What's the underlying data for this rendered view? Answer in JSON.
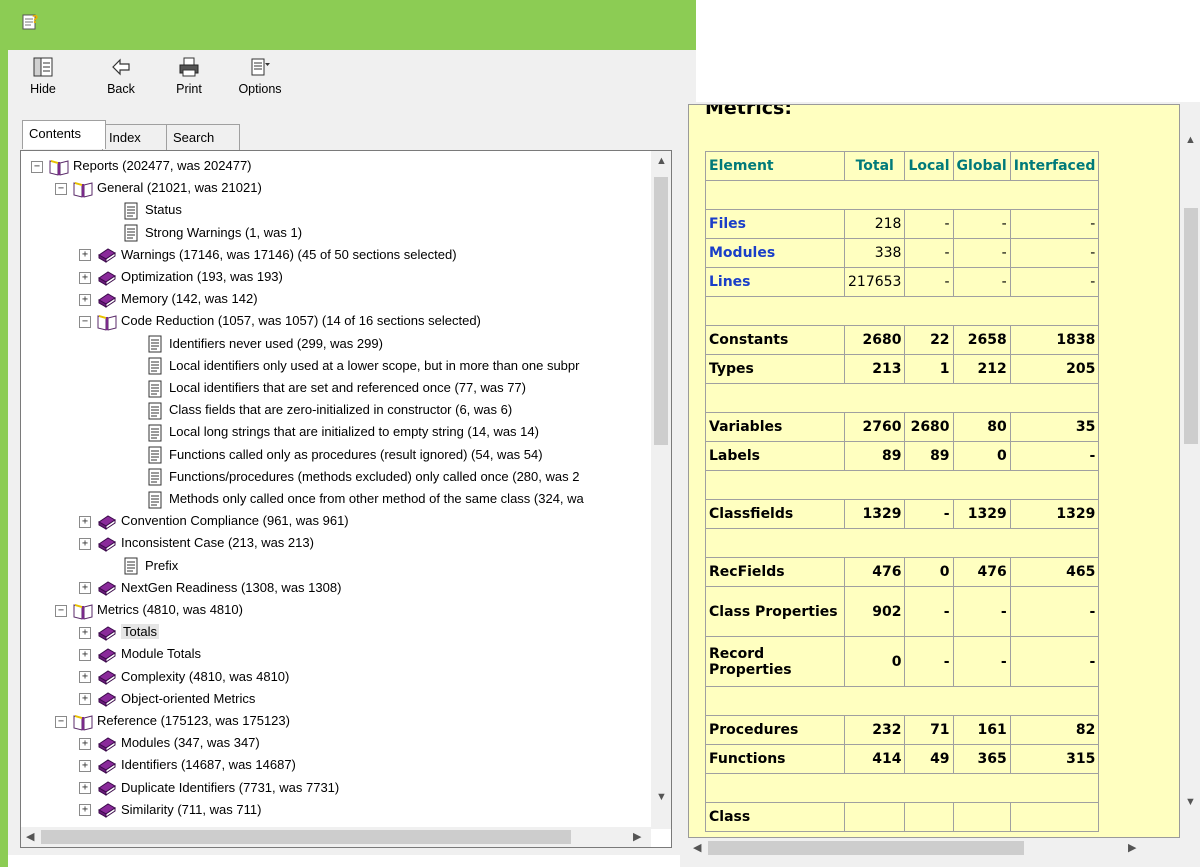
{
  "toolbar": {
    "hide_label": "Hide",
    "back_label": "Back",
    "print_label": "Print",
    "options_label": "Options"
  },
  "tabs": [
    "Contents",
    "Index",
    "Search"
  ],
  "tree": [
    {
      "label": "Reports (202477, was 202477)",
      "icon": "open-book-icon",
      "toggle": "−"
    },
    {
      "label": "General (21021, was 21021)",
      "icon": "open-book-icon",
      "toggle": "−"
    },
    {
      "label": "Status",
      "icon": "page-icon",
      "toggle": ""
    },
    {
      "label": "Strong Warnings (1, was 1)",
      "icon": "page-icon",
      "toggle": ""
    },
    {
      "label": "Warnings (17146, was 17146) (45 of 50 sections selected)",
      "icon": "closed-book-icon",
      "toggle": "+"
    },
    {
      "label": "Optimization (193, was 193)",
      "icon": "closed-book-icon",
      "toggle": "+"
    },
    {
      "label": "Memory (142, was 142)",
      "icon": "closed-book-icon",
      "toggle": "+"
    },
    {
      "label": "Code Reduction (1057, was 1057) (14 of 16 sections selected)",
      "icon": "open-book-icon",
      "toggle": "−"
    },
    {
      "label": "Identifiers never used (299, was 299)",
      "icon": "page-icon",
      "toggle": ""
    },
    {
      "label": "Local identifiers only used at a lower scope, but in more than one subpr",
      "icon": "page-icon",
      "toggle": ""
    },
    {
      "label": "Local identifiers that are set and referenced once (77, was 77)",
      "icon": "page-icon",
      "toggle": ""
    },
    {
      "label": "Class fields that are zero-initialized in constructor (6, was 6)",
      "icon": "page-icon",
      "toggle": ""
    },
    {
      "label": "Local long strings that are initialized to empty string (14, was 14)",
      "icon": "page-icon",
      "toggle": ""
    },
    {
      "label": "Functions called only as procedures (result ignored) (54, was 54)",
      "icon": "page-icon",
      "toggle": ""
    },
    {
      "label": "Functions/procedures (methods excluded) only called once (280, was 2",
      "icon": "page-icon",
      "toggle": ""
    },
    {
      "label": "Methods only called once from other method of the same class (324, wa",
      "icon": "page-icon",
      "toggle": ""
    },
    {
      "label": "Convention Compliance (961, was 961)",
      "icon": "closed-book-icon",
      "toggle": "+"
    },
    {
      "label": "Inconsistent Case (213, was 213)",
      "icon": "closed-book-icon",
      "toggle": "+"
    },
    {
      "label": "Prefix",
      "icon": "page-icon",
      "toggle": ""
    },
    {
      "label": "NextGen Readiness (1308, was 1308)",
      "icon": "closed-book-icon",
      "toggle": "+"
    },
    {
      "label": "Metrics (4810, was 4810)",
      "icon": "open-book-icon",
      "toggle": "−"
    },
    {
      "label": "Totals",
      "icon": "closed-book-icon",
      "toggle": "+"
    },
    {
      "label": "Module Totals",
      "icon": "closed-book-icon",
      "toggle": "+"
    },
    {
      "label": "Complexity (4810, was 4810)",
      "icon": "closed-book-icon",
      "toggle": "+"
    },
    {
      "label": "Object-oriented Metrics",
      "icon": "closed-book-icon",
      "toggle": "+"
    },
    {
      "label": "Reference (175123, was 175123)",
      "icon": "open-book-icon",
      "toggle": "−"
    },
    {
      "label": "Modules (347, was 347)",
      "icon": "closed-book-icon",
      "toggle": "+"
    },
    {
      "label": "Identifiers (14687, was 14687)",
      "icon": "closed-book-icon",
      "toggle": "+"
    },
    {
      "label": "Duplicate Identifiers (7731, was 7731)",
      "icon": "closed-book-icon",
      "toggle": "+"
    },
    {
      "label": "Similarity (711, was 711)",
      "icon": "closed-book-icon",
      "toggle": "+"
    }
  ],
  "metrics": {
    "title": "Metrics:",
    "headers": [
      "Element",
      "Total",
      "Local",
      "Global",
      "Interfaced"
    ],
    "rows": [
      {
        "type": "spacer"
      },
      {
        "type": "link",
        "label": "Files",
        "total": "218",
        "local": "-",
        "global": "-",
        "interfaced": "-"
      },
      {
        "type": "link",
        "label": "Modules",
        "total": "338",
        "local": "-",
        "global": "-",
        "interfaced": "-"
      },
      {
        "type": "link",
        "label": "Lines",
        "total": "217653",
        "local": "-",
        "global": "-",
        "interfaced": "-"
      },
      {
        "type": "spacer"
      },
      {
        "type": "bold",
        "label": "Constants",
        "total": "2680",
        "local": "22",
        "global": "2658",
        "interfaced": "1838"
      },
      {
        "type": "bold",
        "label": "Types",
        "total": "213",
        "local": "1",
        "global": "212",
        "interfaced": "205"
      },
      {
        "type": "spacer"
      },
      {
        "type": "bold",
        "label": "Variables",
        "total": "2760",
        "local": "2680",
        "global": "80",
        "interfaced": "35"
      },
      {
        "type": "bold",
        "label": "Labels",
        "total": "89",
        "local": "89",
        "global": "0",
        "interfaced": "-"
      },
      {
        "type": "spacer"
      },
      {
        "type": "bold",
        "label": "Classfields",
        "total": "1329",
        "local": "-",
        "global": "1329",
        "interfaced": "1329"
      },
      {
        "type": "spacer"
      },
      {
        "type": "bold",
        "label": "RecFields",
        "total": "476",
        "local": "0",
        "global": "476",
        "interfaced": "465"
      },
      {
        "type": "bold2",
        "label": "Class Properties",
        "total": "902",
        "local": "-",
        "global": "-",
        "interfaced": "-"
      },
      {
        "type": "bold2",
        "label": "Record Properties",
        "total": "0",
        "local": "-",
        "global": "-",
        "interfaced": "-"
      },
      {
        "type": "spacer"
      },
      {
        "type": "bold",
        "label": "Procedures",
        "total": "232",
        "local": "71",
        "global": "161",
        "interfaced": "82"
      },
      {
        "type": "bold",
        "label": "Functions",
        "total": "414",
        "local": "49",
        "global": "365",
        "interfaced": "315"
      },
      {
        "type": "spacer"
      },
      {
        "type": "bold",
        "label": "Class",
        "total": "",
        "local": "",
        "global": "",
        "interfaced": ""
      }
    ]
  },
  "colors": {
    "titlebar": "#8ccc54",
    "content_bg": "#ffffc0",
    "header_teal": "#007a7a",
    "link_blue": "#1a3ec8"
  }
}
